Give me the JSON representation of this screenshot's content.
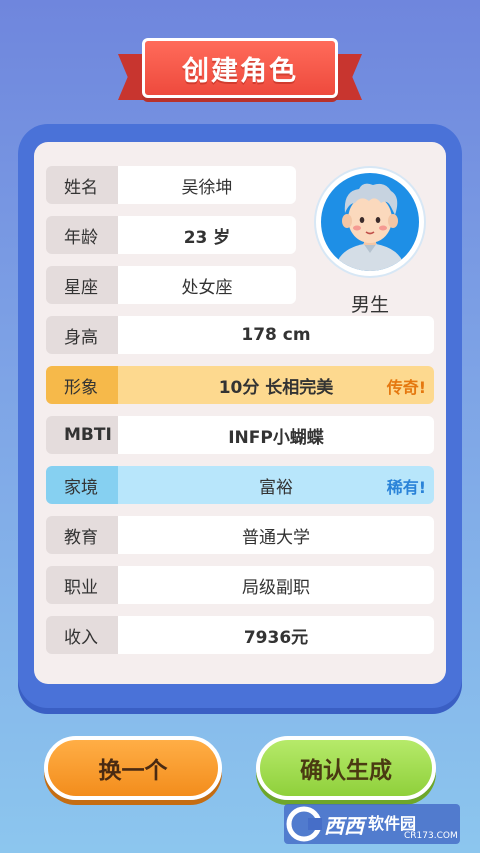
{
  "title": "创建角色",
  "profile": {
    "gender": "男生",
    "rows": [
      {
        "label": "姓名",
        "value": "吴徐坤"
      },
      {
        "label": "年龄",
        "value": "23 岁"
      },
      {
        "label": "星座",
        "value": "处女座"
      },
      {
        "label": "身高",
        "value": "178 cm"
      },
      {
        "label": "形象",
        "value": "10分 长相完美",
        "tag": "传奇!"
      },
      {
        "label": "MBTI",
        "value": "INFP小蝴蝶"
      },
      {
        "label": "家境",
        "value": "富裕",
        "tag": "稀有!"
      },
      {
        "label": "教育",
        "value": "普通大学"
      },
      {
        "label": "职业",
        "value": "局级副职"
      },
      {
        "label": "收入",
        "value": "7936元"
      }
    ]
  },
  "buttons": {
    "swap": "换一个",
    "confirm": "确认生成"
  },
  "watermark": {
    "brand": "西西",
    "site": "软件园",
    "url": "CR173.COM"
  },
  "colors": {
    "legend_tag": "#e5780f",
    "rare_tag": "#2a83d8",
    "card_frame": "#4a72d8"
  }
}
